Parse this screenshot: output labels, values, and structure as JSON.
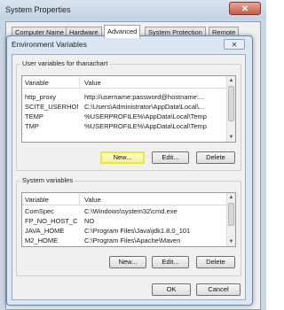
{
  "system_properties": {
    "title": "System Properties",
    "close_glyph": "✕",
    "tabs": [
      {
        "label": "Computer Name",
        "active": false
      },
      {
        "label": "Hardware",
        "active": false
      },
      {
        "label": "Advanced",
        "active": true
      },
      {
        "label": "System Protection",
        "active": false
      },
      {
        "label": "Remote",
        "active": false
      }
    ]
  },
  "env_dialog": {
    "title": "Environment Variables",
    "close_glyph": "✕",
    "user_section": {
      "label": "User variables for thanachart",
      "columns": [
        "Variable",
        "Value"
      ],
      "rows": [
        {
          "variable": "http_proxy",
          "value": "http://username:password@hostname:..."
        },
        {
          "variable": "SCITE_USERHOME",
          "value": "C:\\Users\\Administrator\\AppData\\Local\\..."
        },
        {
          "variable": "TEMP",
          "value": "%USERPROFILE%\\AppData\\Local\\Temp"
        },
        {
          "variable": "TMP",
          "value": "%USERPROFILE%\\AppData\\Local\\Temp"
        }
      ],
      "buttons": {
        "new": "New...",
        "edit": "Edit...",
        "delete": "Delete"
      }
    },
    "system_section": {
      "label": "System variables",
      "columns": [
        "Variable",
        "Value"
      ],
      "rows": [
        {
          "variable": "ComSpec",
          "value": "C:\\Windows\\system32\\cmd.exe"
        },
        {
          "variable": "FP_NO_HOST_C...",
          "value": "NO"
        },
        {
          "variable": "JAVA_HOME",
          "value": "C:\\Program Files\\Java\\jdk1.8.0_101"
        },
        {
          "variable": "M2_HOME",
          "value": "C:\\Program Files\\Apache\\Maven"
        }
      ],
      "buttons": {
        "new": "New...",
        "edit": "Edit...",
        "delete": "Delete"
      }
    },
    "footer": {
      "ok": "OK",
      "cancel": "Cancel"
    }
  },
  "colors": {
    "highlight_ring": "#e7e83a",
    "dialog_frame": "#dbe6f2",
    "selection": "#dbe9f7"
  }
}
